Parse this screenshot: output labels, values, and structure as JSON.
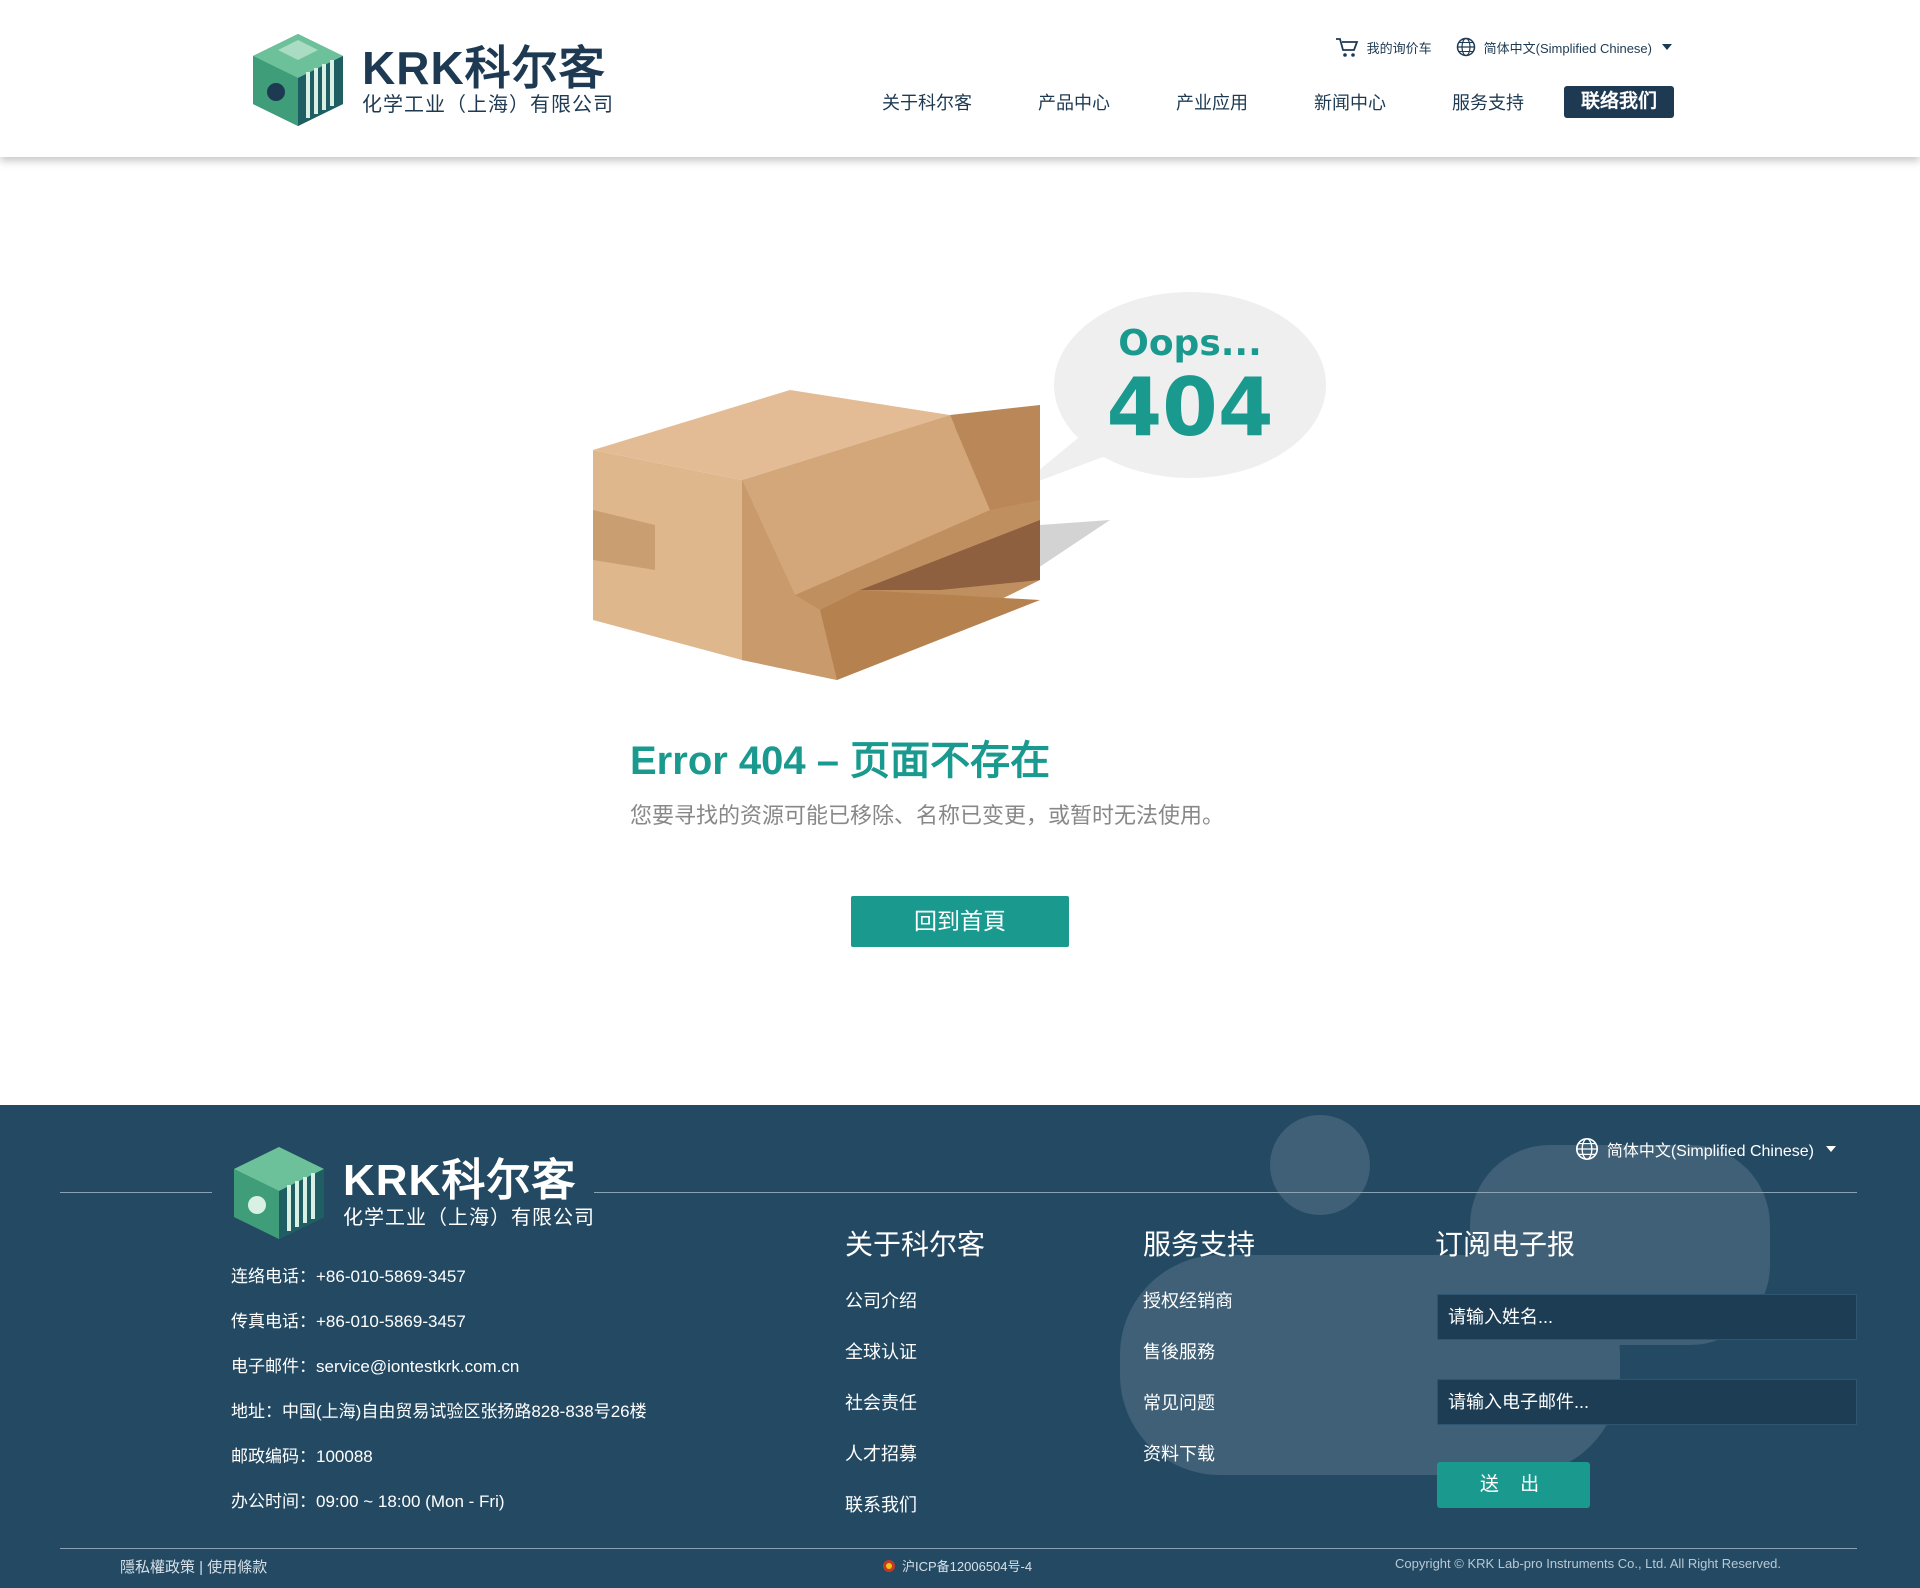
{
  "header": {
    "logo_title": "KRK科尔客",
    "logo_sub": "化学工业（上海）有限公司",
    "cart_label": "我的询价车",
    "language": "简体中文(Simplified Chinese)",
    "nav": [
      {
        "label": "关于科尔客"
      },
      {
        "label": "产品中心"
      },
      {
        "label": "产业应用"
      },
      {
        "label": "新闻中心"
      },
      {
        "label": "服务支持"
      }
    ],
    "cta_label": "联络我们"
  },
  "main": {
    "bubble_oops": "Oops...",
    "bubble_code": "404",
    "error_title": "Error 404 – 页面不存在",
    "error_desc": "您要寻找的资源可能已移除、名称已变更，或暂时无法使用。",
    "home_button": "回到首頁"
  },
  "footer": {
    "logo_title": "KRK科尔客",
    "logo_sub": "化学工业（上海）有限公司",
    "language": "简体中文(Simplified Chinese)",
    "contact": {
      "phone": "连络电话：+86-010-5869-3457",
      "fax": "传真电话：+86-010-5869-3457",
      "email": "电子邮件：service@iontestkrk.com.cn",
      "address": "地址：中国(上海)自由贸易试验区张扬路828-838号26楼",
      "postcode": "邮政编码：100088",
      "hours": "办公时间：09:00 ~ 18:00 (Mon - Fri)"
    },
    "about": {
      "title": "关于科尔客",
      "links": [
        "公司介绍",
        "全球认证",
        "社会责任",
        "人才招募",
        "联系我们"
      ]
    },
    "service": {
      "title": "服务支持",
      "links": [
        "授权经销商",
        "售後服務",
        "常见问题",
        "资料下载"
      ]
    },
    "newsletter": {
      "title": "订阅电子报",
      "name_placeholder": "请输入姓名...",
      "email_placeholder": "请输入电子邮件...",
      "submit": "送 出"
    },
    "legal": "隱私權政策 | 使用條款",
    "icp": "沪ICP备12006504号-4",
    "copyright": "Copyright © KRK Lab-pro Instruments Co., Ltd. All Right Reserved."
  },
  "colors": {
    "navy": "#1e3a52",
    "teal": "#1a9a8e",
    "footer_bg": "#244a63"
  }
}
